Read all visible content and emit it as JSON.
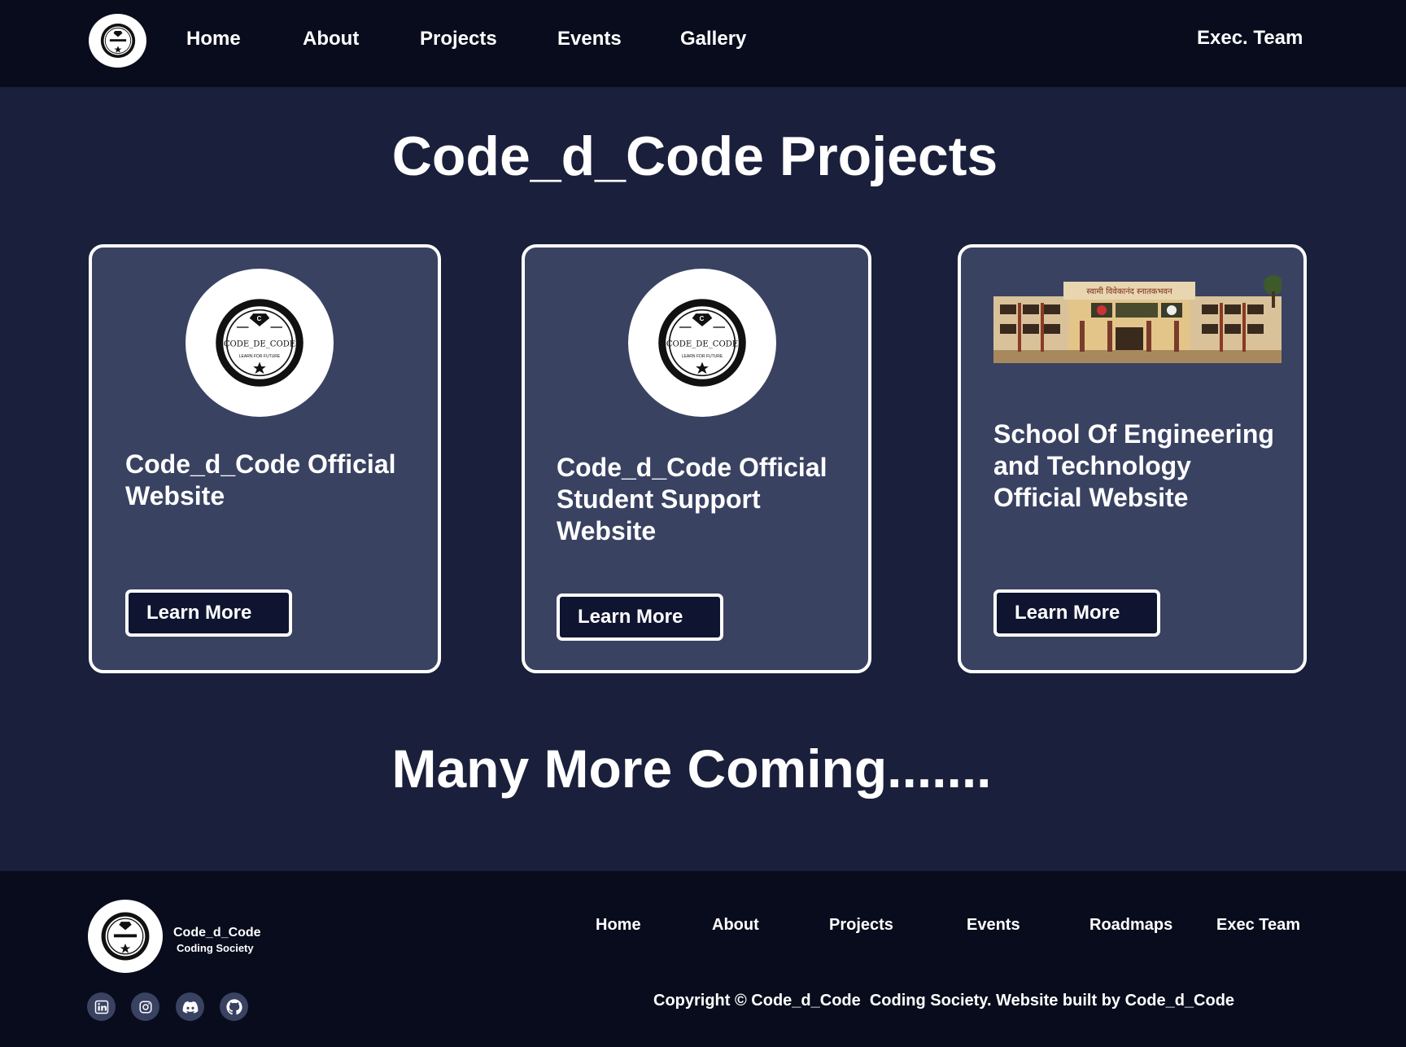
{
  "header": {
    "logo_icon": "code-d-code-badge",
    "nav": [
      {
        "label": "Home"
      },
      {
        "label": "About"
      },
      {
        "label": "Projects"
      },
      {
        "label": "Events"
      },
      {
        "label": "Gallery"
      }
    ],
    "exec_team": "Exec. Team"
  },
  "main": {
    "title": "Code_d_Code Projects",
    "badge_text": "CODE_DE_CODE",
    "badge_tagline": "LEARN FOR FUTURE",
    "cards": [
      {
        "title": "Code_d_Code Official\nWebsite",
        "button": "Learn More",
        "image": "code-d-code-badge"
      },
      {
        "title": "Code_d_Code Official\nStudent Support\nWebsite",
        "button": "Learn More",
        "image": "code-d-code-badge"
      },
      {
        "title": "School Of Engineering\nand Technology\nOfficial  Website",
        "button": "Learn More",
        "image": "college-building-photo",
        "building_sign": "स्वामी विवेकानंद स्नातकभवन"
      }
    ],
    "coming": "Many More Coming......."
  },
  "footer": {
    "brand": "Code_d_Code",
    "subtitle": "Coding Society",
    "links": [
      {
        "label": "Home"
      },
      {
        "label": "About"
      },
      {
        "label": "Projects"
      },
      {
        "label": "Events"
      },
      {
        "label": "Roadmaps"
      },
      {
        "label": "Exec Team"
      }
    ],
    "socials": [
      "linkedin-icon",
      "instagram-icon",
      "discord-icon",
      "github-icon"
    ],
    "copyright": "Copyright © Code_d_Code  Coding Society. Website built by Code_d_Code"
  },
  "colors": {
    "page_bg": "#1a1f3b",
    "header_bg": "#080c1c",
    "card_bg": "#3a4262",
    "button_bg": "#0f1430"
  }
}
